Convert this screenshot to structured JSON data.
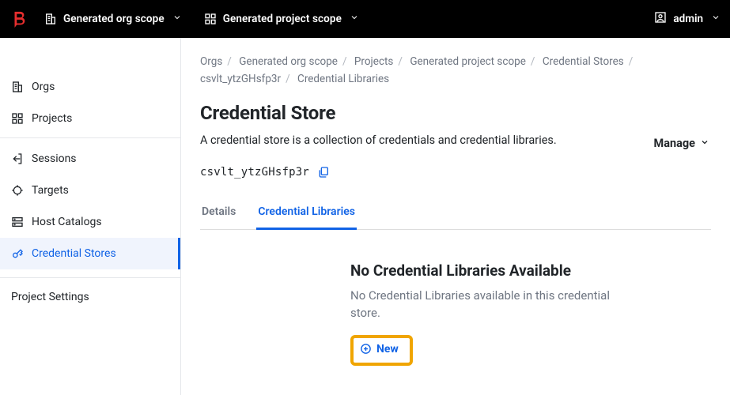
{
  "brandColor": "#e62e2e",
  "topbar": {
    "orgScope": "Generated org scope",
    "projectScope": "Generated project scope",
    "user": "admin"
  },
  "sidebar": {
    "group1": [
      {
        "label": "Orgs",
        "icon": "org"
      },
      {
        "label": "Projects",
        "icon": "grid"
      }
    ],
    "group2": [
      {
        "label": "Sessions",
        "icon": "exit"
      },
      {
        "label": "Targets",
        "icon": "crosshair"
      },
      {
        "label": "Host Catalogs",
        "icon": "server"
      },
      {
        "label": "Credential Stores",
        "icon": "key",
        "active": true
      }
    ],
    "settings": "Project Settings"
  },
  "breadcrumbs": [
    "Orgs",
    "Generated org scope",
    "Projects",
    "Generated project scope",
    "Credential Stores",
    "csvlt_ytzGHsfp3r",
    "Credential Libraries"
  ],
  "page": {
    "title": "Credential Store",
    "subtitle": "A credential store is a collection of credentials and credential libraries.",
    "manage": "Manage",
    "id": "csvlt_ytzGHsfp3r"
  },
  "tabs": [
    {
      "label": "Details"
    },
    {
      "label": "Credential Libraries",
      "active": true
    }
  ],
  "empty": {
    "heading": "No Credential Libraries Available",
    "body": "No Credential Libraries available in this credential store.",
    "action": "New"
  }
}
